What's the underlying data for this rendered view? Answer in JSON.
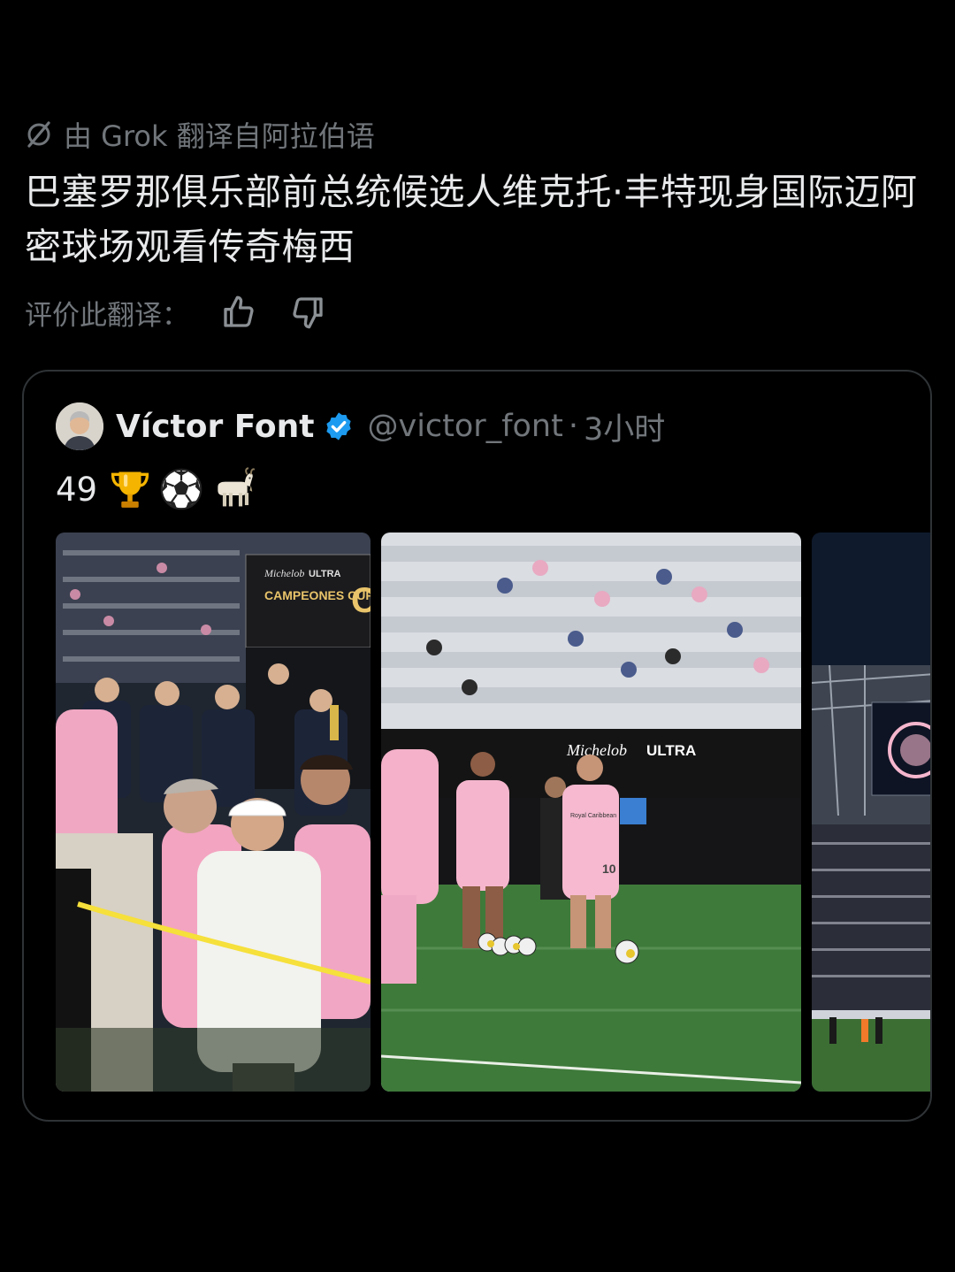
{
  "translation": {
    "source_label": "由 Grok 翻译自阿拉伯语",
    "text": "巴塞罗那俱乐部前总统候选人维克托·丰特现身国际迈阿密球场观看传奇梅西",
    "rate_label": "评价此翻译："
  },
  "quote": {
    "author_name": "Víctor Font",
    "handle": "@victor_font",
    "separator": "·",
    "time": "3小时",
    "body_text": "49",
    "emojis": [
      "trophy-emoji",
      "soccer-ball-emoji",
      "goat-emoji"
    ]
  },
  "media": {
    "signage": {
      "brand": "Michelob",
      "ultra": "ULTRA",
      "cup": "CAMPEONES CUP",
      "letter": "C"
    },
    "jersey": {
      "sponsor": "Royal Caribbean",
      "number": "10"
    }
  },
  "colors": {
    "background": "#000000",
    "text_primary": "#e7e9ea",
    "text_secondary": "#71767b",
    "card_border": "#2f3336",
    "verified_blue": "#1d9bf0",
    "inter_pink": "#f5b6cd",
    "pitch_green": "#3e7a3a"
  },
  "icons": [
    "grok-icon",
    "thumbs-up-icon",
    "thumbs-down-icon",
    "verified-badge-icon"
  ]
}
